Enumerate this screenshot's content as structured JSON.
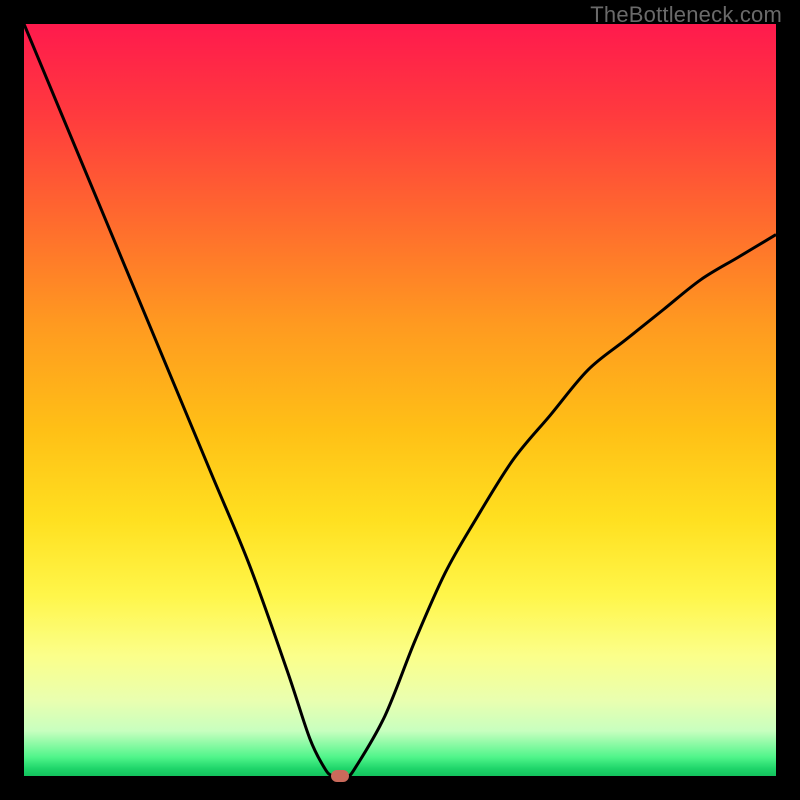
{
  "watermark_text": "TheBottleneck.com",
  "colors": {
    "frame": "#000000",
    "marker_fill": "#c96a5b",
    "curve_stroke": "#000000",
    "gradient_css": "linear-gradient(to bottom, #ff1a4d 0%, #ff3a3e 12%, #ff6a2e 26%, #ff9a20 40%, #ffc016 54%, #ffe020 66%, #fff64a 76%, #fbff8a 84%, #e9ffb0 90%, #c8ffbf 94%, #50f58a 97.5%, #1fd56a 99%, #13c25d 100%)"
  },
  "chart_data": {
    "type": "line",
    "title": "",
    "xlabel": "",
    "ylabel": "",
    "x_range": [
      0,
      100
    ],
    "y_range": [
      0,
      100
    ],
    "x": [
      0,
      5,
      10,
      15,
      20,
      25,
      30,
      35,
      38,
      40,
      41,
      42,
      43,
      44,
      48,
      52,
      56,
      60,
      65,
      70,
      75,
      80,
      85,
      90,
      95,
      100
    ],
    "values": [
      100,
      88,
      76,
      64,
      52,
      40,
      28,
      14,
      5,
      1,
      0,
      0,
      0,
      1,
      8,
      18,
      27,
      34,
      42,
      48,
      54,
      58,
      62,
      66,
      69,
      72
    ],
    "minimum": {
      "x": 41.5,
      "y": 0
    },
    "marker": {
      "x": 42,
      "y": 0
    },
    "note": "Values are read from the plotted curve as percentage of the plot height (0 = bottom green band, 100 = top edge)."
  }
}
